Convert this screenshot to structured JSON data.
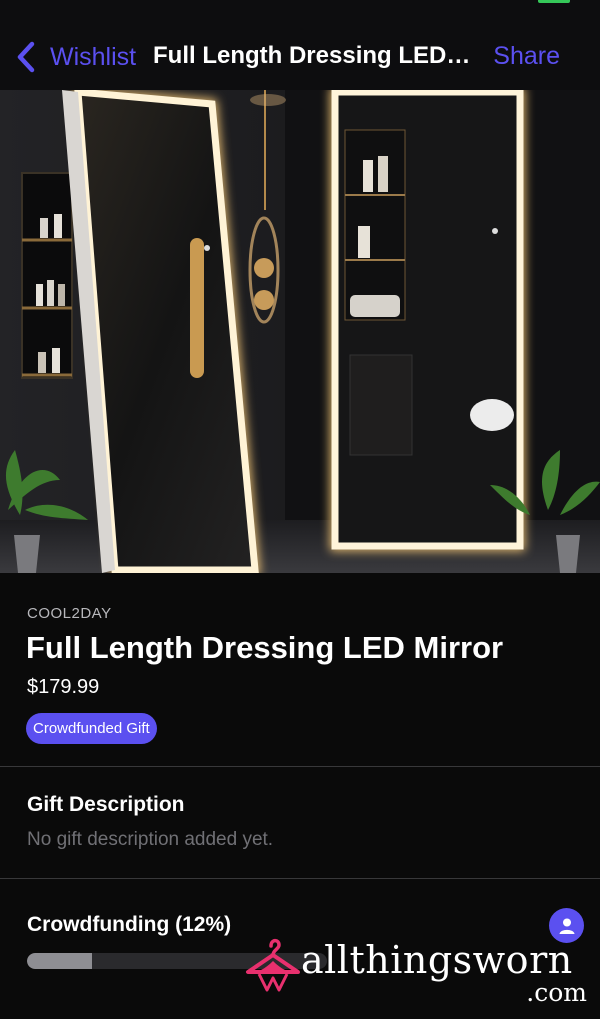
{
  "nav": {
    "back_label": "Wishlist",
    "title": "Full Length Dressing LED Mirror",
    "share_label": "Share"
  },
  "product": {
    "seller": "COOL2DAY",
    "title": "Full Length Dressing LED Mirror",
    "price": "$179.99",
    "badge": "Crowdfunded Gift"
  },
  "description": {
    "heading": "Gift Description",
    "text": "No gift description added yet."
  },
  "crowdfunding": {
    "heading": "Crowdfunding (12%)",
    "progress_percent": 12
  },
  "watermark": {
    "main": "allthingsworn",
    "suffix": ".com"
  },
  "colors": {
    "accent": "#5b50f0",
    "background": "#000000",
    "watermark_pink": "#e8306e"
  }
}
